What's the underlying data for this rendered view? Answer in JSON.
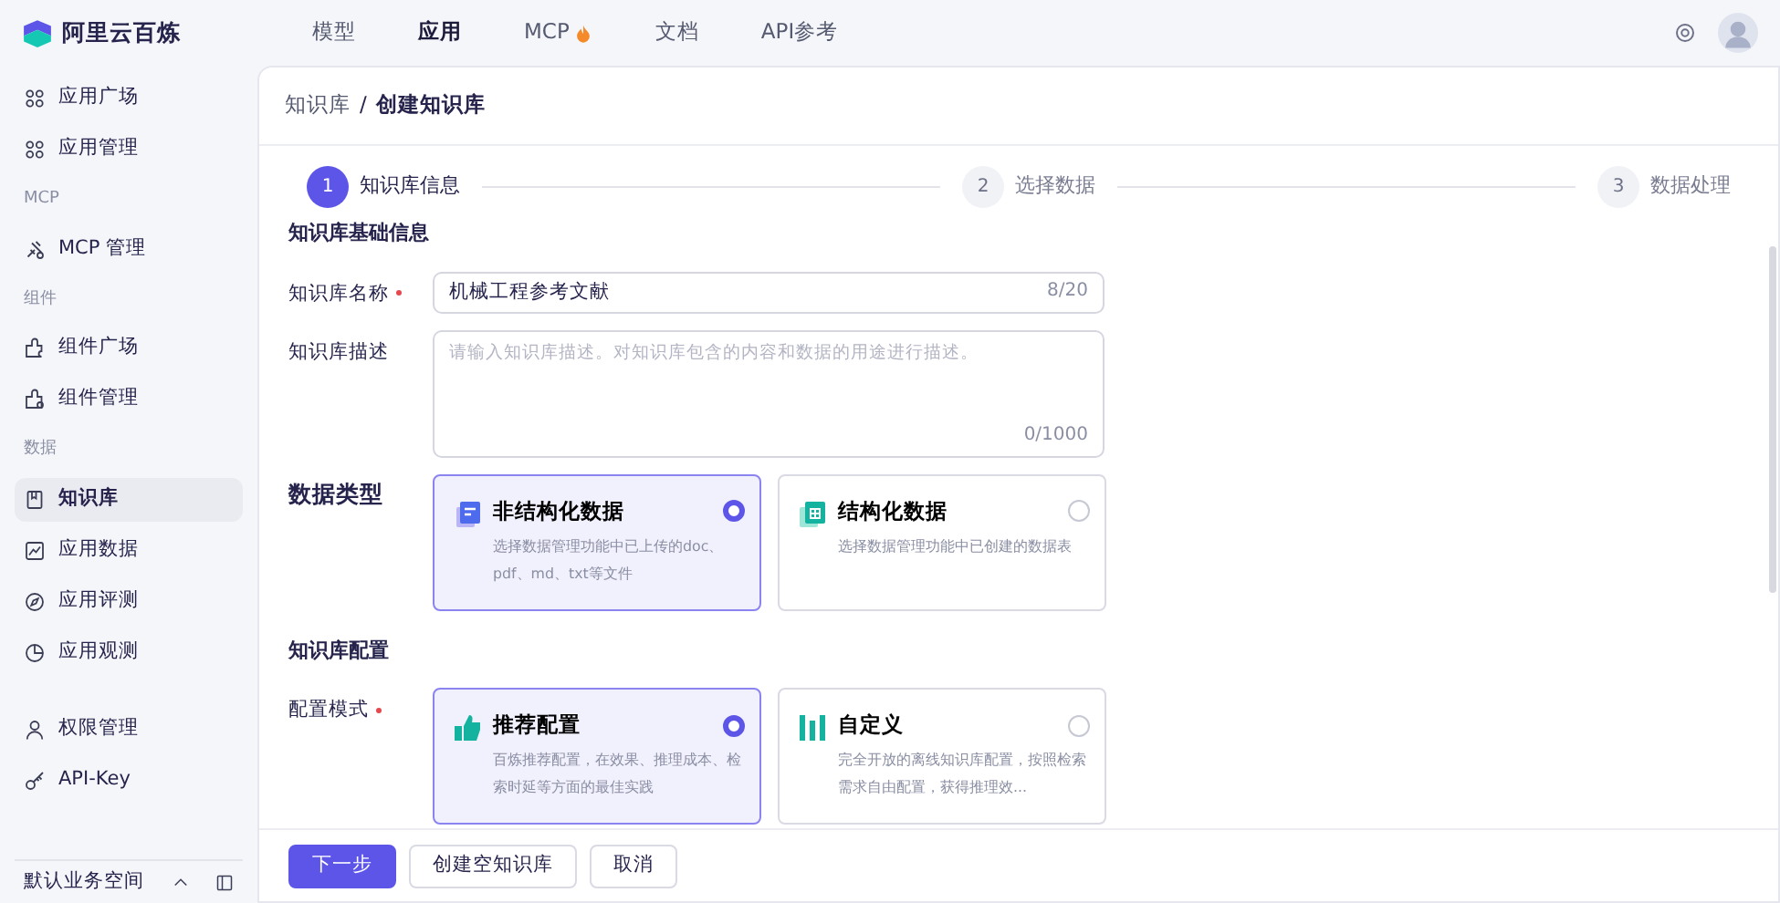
{
  "brand": {
    "name": "阿里云百炼"
  },
  "top_nav": [
    {
      "label": "模型",
      "selected": false
    },
    {
      "label": "应用",
      "selected": true
    },
    {
      "label": "MCP",
      "selected": false,
      "hot": true
    },
    {
      "label": "文档",
      "selected": false
    },
    {
      "label": "API参考",
      "selected": false
    }
  ],
  "sidebar": {
    "groups": [
      {
        "items": [
          {
            "label": "应用广场",
            "selected": false
          },
          {
            "label": "应用管理",
            "selected": false
          }
        ]
      },
      {
        "header": "MCP",
        "items": [
          {
            "label": "MCP 管理",
            "selected": false
          }
        ]
      },
      {
        "header": "组件",
        "items": [
          {
            "label": "组件广场",
            "selected": false
          },
          {
            "label": "组件管理",
            "selected": false
          }
        ]
      },
      {
        "header": "数据",
        "items": [
          {
            "label": "知识库",
            "selected": true
          },
          {
            "label": "应用数据",
            "selected": false
          },
          {
            "label": "应用评测",
            "selected": false
          },
          {
            "label": "应用观测",
            "selected": false
          }
        ]
      },
      {
        "items": [
          {
            "label": "权限管理",
            "selected": false
          },
          {
            "label": "API-Key",
            "selected": false
          }
        ]
      }
    ],
    "workspace": "默认业务空间"
  },
  "breadcrumb": {
    "items": [
      "知识库",
      "创建知识库"
    ],
    "separator": "/"
  },
  "steps": [
    {
      "number": "1",
      "label": "知识库信息",
      "active": true
    },
    {
      "number": "2",
      "label": "选择数据",
      "active": false
    },
    {
      "number": "3",
      "label": "数据处理",
      "active": false
    }
  ],
  "basic_section": {
    "title": "知识库基础信息",
    "name_field": {
      "label": "知识库名称",
      "required": true,
      "value": "机械工程参考文献",
      "counter": "8/20"
    },
    "description_field": {
      "label": "知识库描述",
      "placeholder": "请输入知识库描述。对知识库包含的内容和数据的用途进行描述。",
      "counter": "0/1000"
    }
  },
  "data_type": {
    "label": "数据类型",
    "options": [
      {
        "title": "非结构化数据",
        "description": "选择数据管理功能中已上传的doc、pdf、md、txt等文件",
        "selected": true
      },
      {
        "title": "结构化数据",
        "description": "选择数据管理功能中已创建的数据表",
        "selected": false
      }
    ]
  },
  "config_section": {
    "title": "知识库配置",
    "label": "配置模式",
    "required": true,
    "options": [
      {
        "title": "推荐配置",
        "description": "百炼推荐配置，在效果、推理成本、检索时延等方面的最佳实践",
        "selected": true
      },
      {
        "title": "自定义",
        "description": "完全开放的离线知识库配置，按照检索需求自由配置，获得推理效...",
        "selected": false
      }
    ]
  },
  "footer_buttons": [
    {
      "label": "下一步",
      "kind": "primary"
    },
    {
      "label": "创建空知识库",
      "kind": "secondary"
    },
    {
      "label": "取消",
      "kind": "secondary"
    }
  ]
}
